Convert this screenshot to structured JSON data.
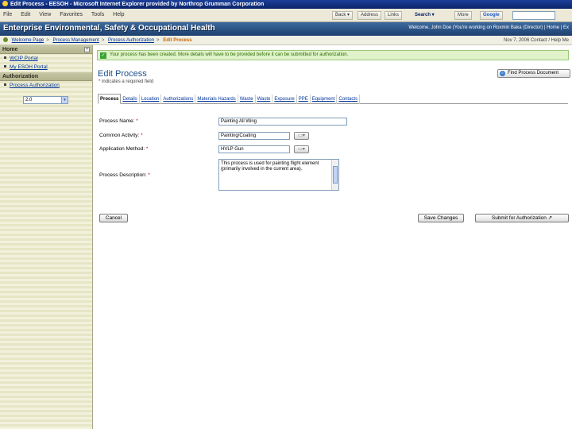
{
  "window": {
    "title": "Edit Process - EESOH - Microsoft Internet Explorer provided by Northrop Grumman Corporation"
  },
  "menu": {
    "items": [
      "File",
      "Edit",
      "View",
      "Favorites",
      "Tools",
      "Help"
    ],
    "back_label": "Back",
    "address_label": "Address",
    "links_label": "Links",
    "search_label": "Search",
    "more_label": "More",
    "google_label": "Google"
  },
  "header": {
    "app_title": "Enterprise Environmental, Safety & Occupational Health",
    "user_info": "Welcome, John Doe (You're working on Roxmin Baka (Director) | Home | Ex"
  },
  "breadcrumb": {
    "items": [
      "Welcome Page",
      "Process Management",
      "Process Authorization"
    ],
    "current": "Edit Process",
    "date_info": "Nov 7, 2006 Contact / Help Me"
  },
  "sidebar": {
    "home_heading": "Home",
    "home_items": [
      "WCIP Portal",
      "My ESOH Portal"
    ],
    "auth_heading": "Authorization",
    "auth_items": [
      "Process Authorization"
    ],
    "select_value": "2.0"
  },
  "main": {
    "success_message": "Your process has been created. More details will have to be provided before it can be submitted for authorization.",
    "page_title": "Edit Process",
    "required_note": "indicates a required field",
    "find_button": "Find Process Document",
    "tabs": [
      "Process",
      "Details",
      "Location",
      "Authorizations",
      "Materials Hazards",
      "Waste",
      "Waste",
      "Exposure",
      "PPE",
      "Equipment",
      "Contacts"
    ],
    "active_tab_index": 0,
    "fields": {
      "process_name_label": "Process Name:",
      "process_name_value": "Painting All Wing",
      "common_activity_label": "Common Activity:",
      "common_activity_value": "Painting/Coating",
      "application_method_label": "Application Method:",
      "application_method_value": "HVLP Gun",
      "description_label": "Process Description:",
      "description_value": "This process is used for painting flight element (primarily involved in the current area)."
    },
    "buttons": {
      "cancel": "Cancel",
      "save": "Save Changes",
      "submit": "Submit for Authorization"
    }
  }
}
